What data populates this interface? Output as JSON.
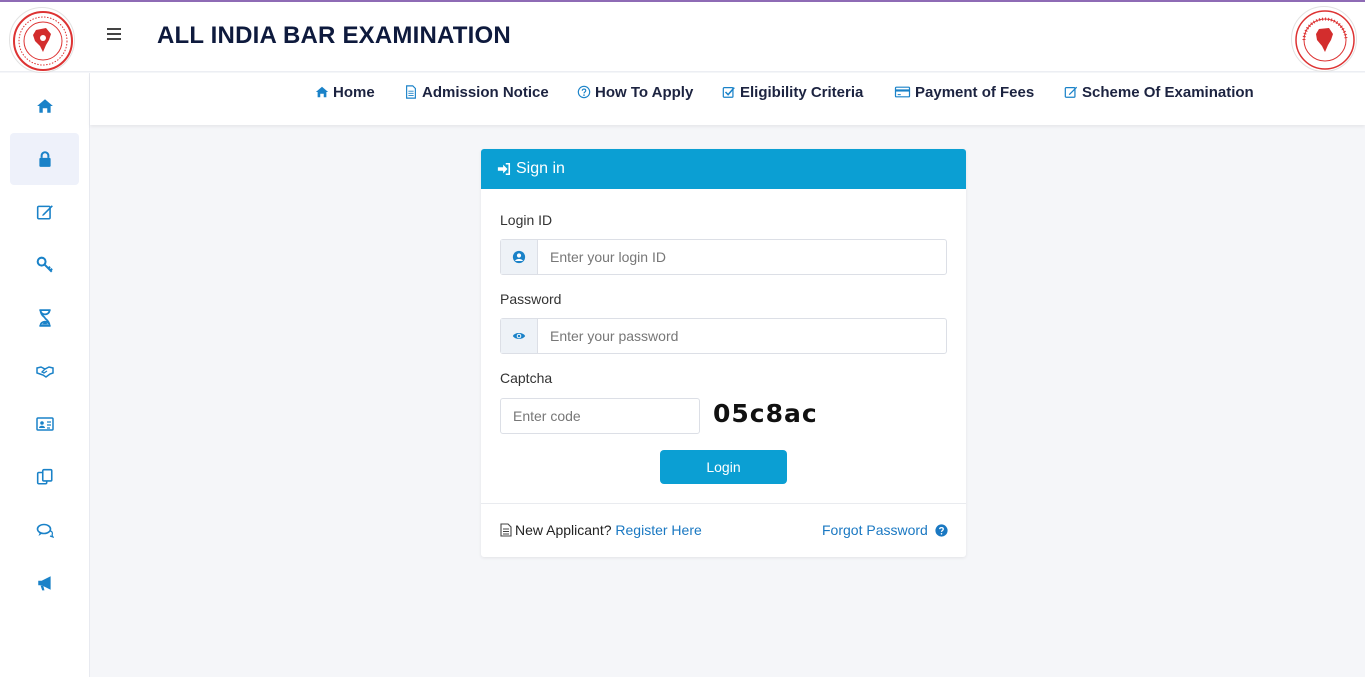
{
  "app": {
    "title": "ALL INDIA BAR EXAMINATION"
  },
  "nav": [
    {
      "label": "Home",
      "icon": "home-icon"
    },
    {
      "label": "Admission Notice",
      "icon": "document-icon"
    },
    {
      "label": "How To Apply",
      "icon": "question-circle-icon"
    },
    {
      "label": "Eligibility Criteria",
      "icon": "edit-check-icon"
    },
    {
      "label": "Payment of Fees",
      "icon": "credit-card-icon"
    },
    {
      "label": "Scheme Of Examination",
      "icon": "edit-icon"
    }
  ],
  "sidebar": [
    {
      "icon": "home-icon",
      "active": false
    },
    {
      "icon": "lock-icon",
      "active": true
    },
    {
      "icon": "edit-icon",
      "active": false
    },
    {
      "icon": "key-icon",
      "active": false
    },
    {
      "icon": "hourglass-icon",
      "active": false
    },
    {
      "icon": "handshake-icon",
      "active": false
    },
    {
      "icon": "id-card-icon",
      "active": false
    },
    {
      "icon": "copy-icon",
      "active": false
    },
    {
      "icon": "comments-icon",
      "active": false
    },
    {
      "icon": "bullhorn-icon",
      "active": false
    }
  ],
  "signin": {
    "title": "Sign in",
    "login_label": "Login ID",
    "login_placeholder": "Enter your login ID",
    "password_label": "Password",
    "password_placeholder": "Enter your password",
    "captcha_label": "Captcha",
    "captcha_placeholder": "Enter code",
    "captcha_code": "05c8ac",
    "login_button": "Login",
    "new_applicant": "New Applicant?",
    "register_link": "Register Here",
    "forgot_link": "Forgot Password"
  },
  "colors": {
    "accent": "#0b9fd3",
    "title": "#0e1a3d",
    "link": "#1a78c2",
    "topline": "#8e6bb5"
  }
}
